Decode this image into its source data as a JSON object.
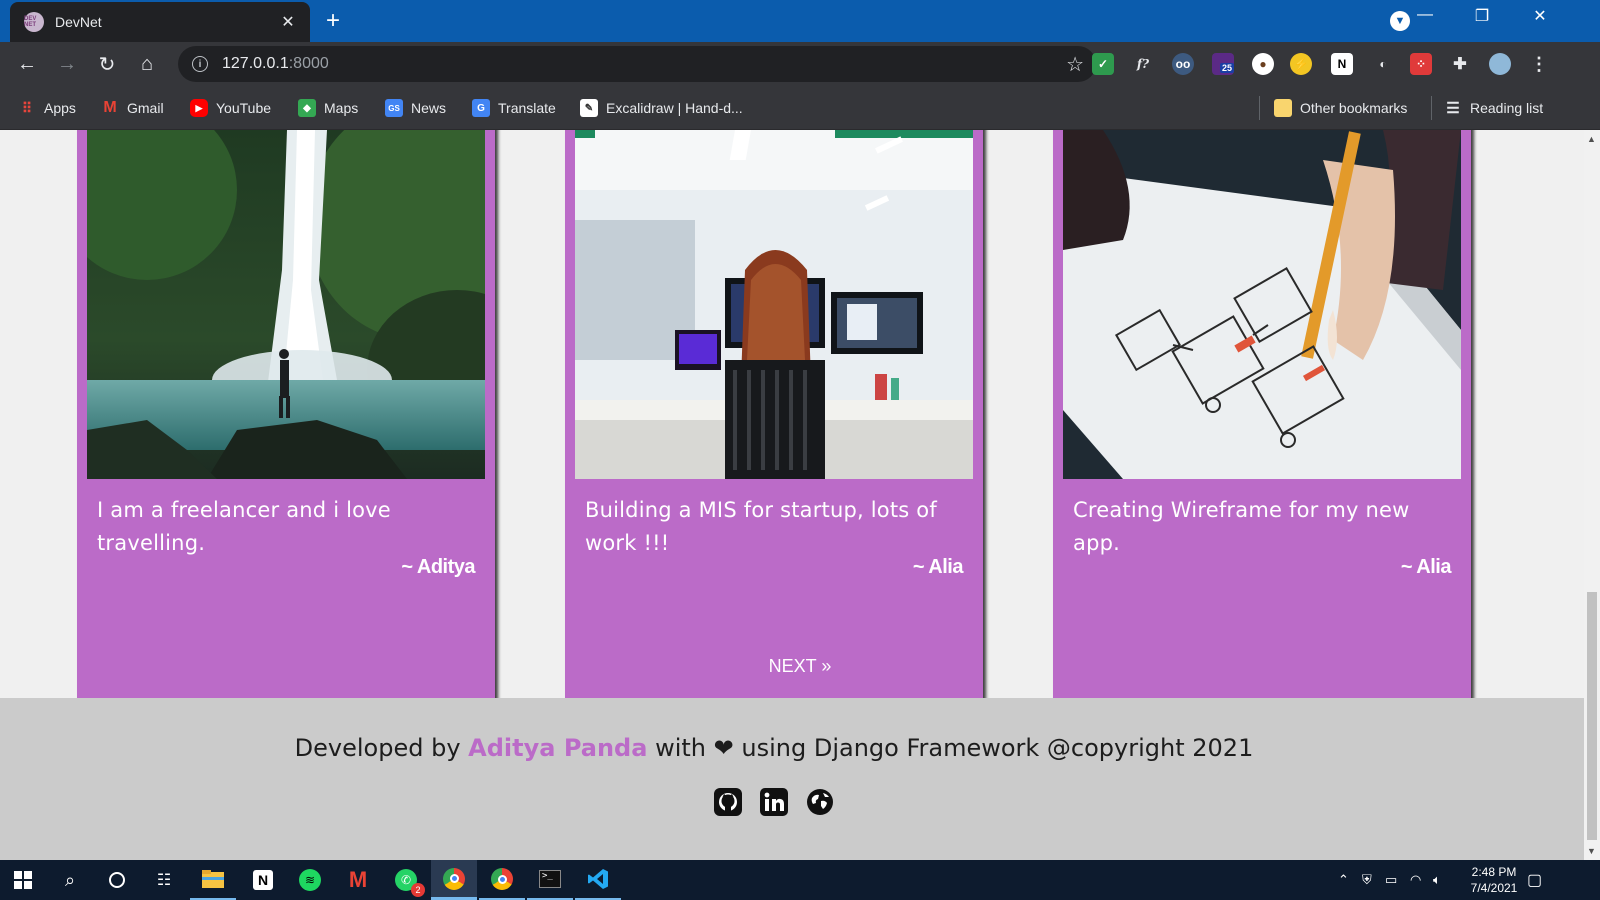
{
  "browser": {
    "tab_title": "DevNet",
    "favicon_text": "DEV NET",
    "url_host": "127.0.0.1",
    "url_port": ":8000",
    "extension_badge": "25",
    "bookmarks": [
      {
        "label": "Apps"
      },
      {
        "label": "Gmail"
      },
      {
        "label": "YouTube"
      },
      {
        "label": "Maps"
      },
      {
        "label": "News"
      },
      {
        "label": "Translate"
      },
      {
        "label": "Excalidraw | Hand-d..."
      }
    ],
    "other_bookmarks": "Other bookmarks",
    "reading_list": "Reading list"
  },
  "posts": [
    {
      "caption": "I am a freelancer and i love travelling.",
      "author": "~ Aditya",
      "image": "waterfall-photo"
    },
    {
      "caption": "Building a MIS for startup, lots of work !!!",
      "author": "~ Alia",
      "image": "office-photo"
    },
    {
      "caption": "Creating Wireframe for my new app.",
      "author": "~ Alia",
      "image": "wireframe-sketch-photo"
    }
  ],
  "pagination": {
    "next_label": "NEXT »"
  },
  "footer": {
    "prefix": "Developed by",
    "author": "Aditya Panda",
    "with": "with",
    "suffix": "using Django Framework @copyright 2021",
    "icons": [
      "github-icon",
      "linkedin-icon",
      "globe-icon"
    ]
  },
  "taskbar": {
    "time": "2:48 PM",
    "date": "7/4/2021",
    "whatsapp_badge": "2"
  },
  "colors": {
    "accent": "#bb6bc8",
    "tab_strip": "#0b5cad",
    "taskbar": "#0d1b2e"
  }
}
